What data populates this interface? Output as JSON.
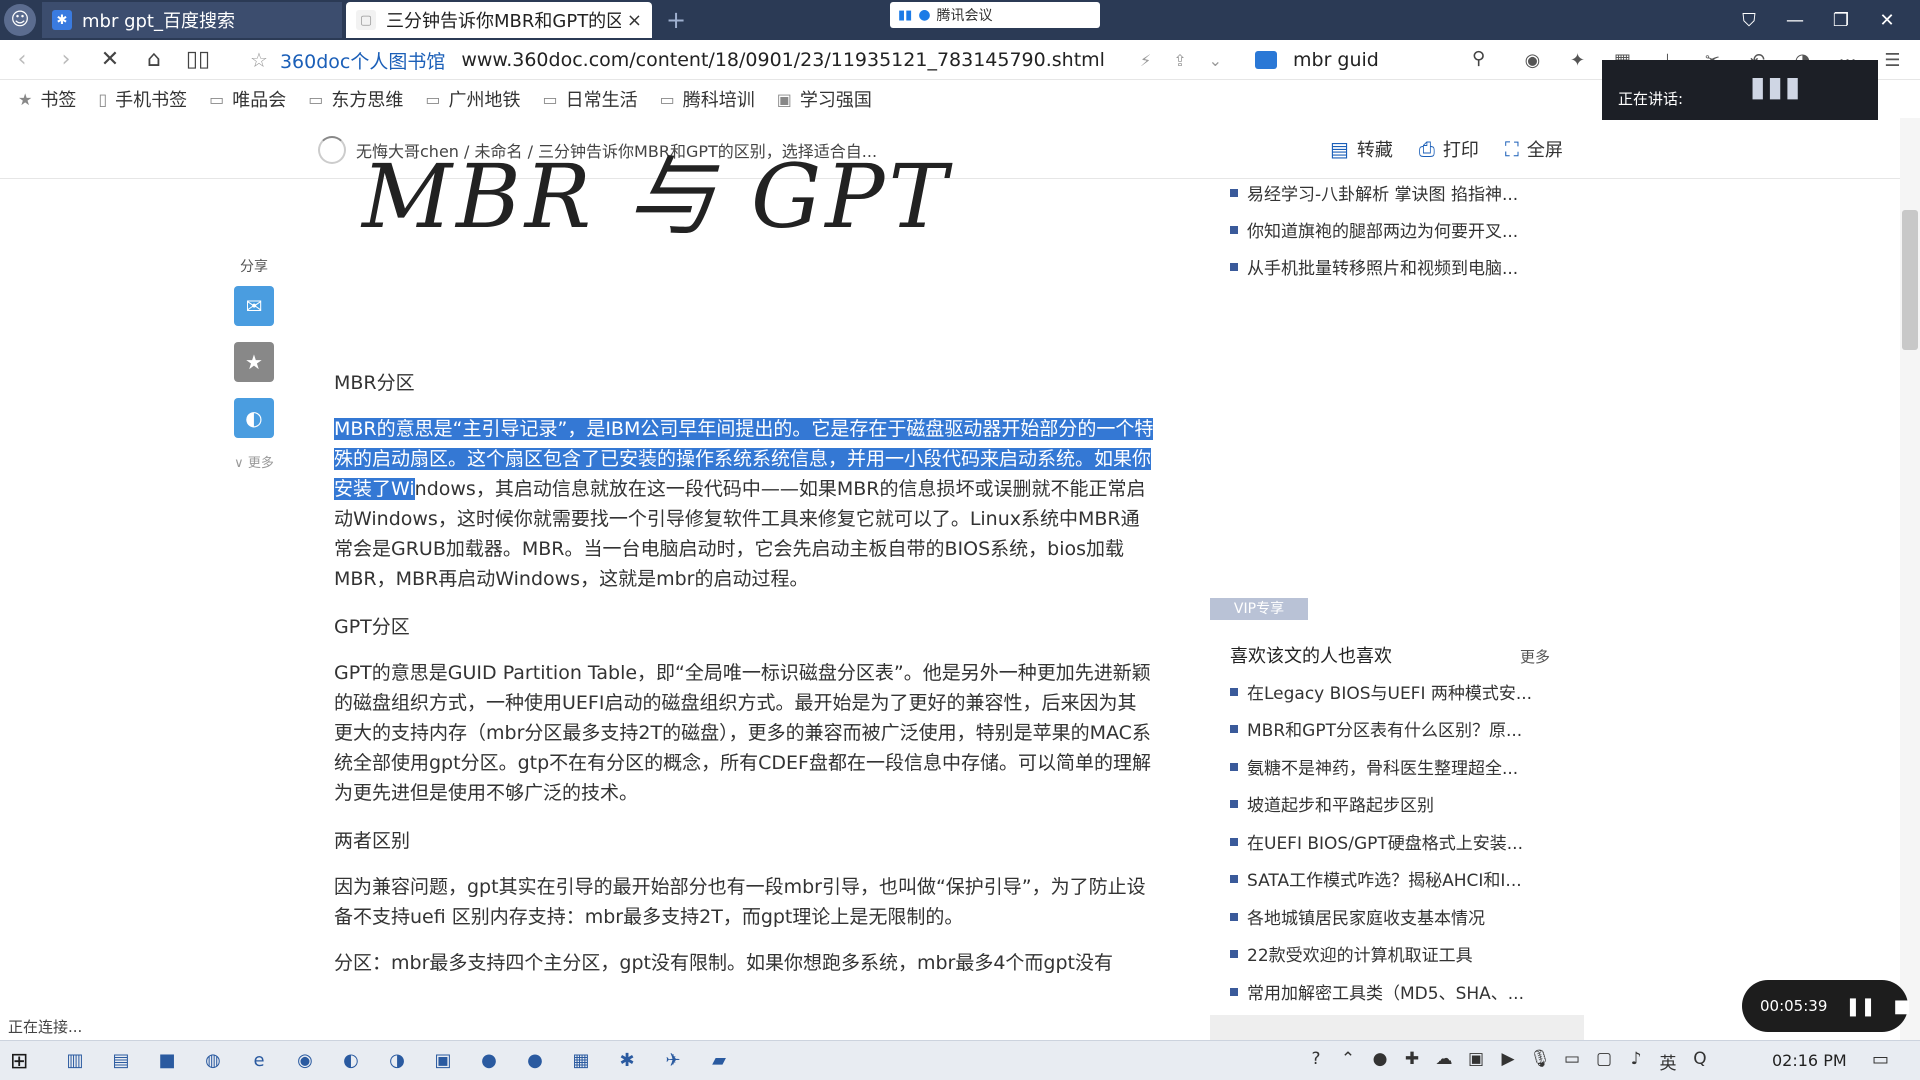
{
  "tabs": [
    {
      "title": "mbr gpt_百度搜索"
    },
    {
      "title": "三分钟告诉你MBR和GPT的区别",
      "close": "×"
    }
  ],
  "new_tab": "+",
  "meeting": {
    "label": "腾讯会议"
  },
  "nav": {
    "site_name": "360doc个人图书馆",
    "url": "www.360doc.com/content/18/0901/23/11935121_783145790.shtml",
    "search_query": "mbr guid"
  },
  "bookmarks": [
    "书签",
    "手机书签",
    "唯品会",
    "东方思维",
    "广州地铁",
    "日常生活",
    "腾科培训",
    "学习强国"
  ],
  "speaking": {
    "label": "正在讲话:"
  },
  "breadcrumb": "无悔大哥chen / 未命名 / 三分钟告诉你MBR和GPT的区别，选择适合自...",
  "actions": {
    "repost": "转藏",
    "print": "打印",
    "fullscreen": "全屏"
  },
  "share": {
    "label": "分享",
    "more": "更多"
  },
  "article": {
    "banner": "MBR 与 GPT",
    "sec1_title": "MBR分区",
    "p1_hl1": "MBR的意思是“主引导记录”，是IBM公司早年间提出的。它是存在于磁盘驱动器开始部分",
    "p1_hl2": "的一个特殊的启动扇区。这个扇区包含了已安装的操作系统系统信息，并用一小段代码来启动",
    "p1_hl3": "系统。如果你安装了Wi",
    "p1_rest": "ndows，其启动信息就放在这一段代码中——如果MBR的信息损坏或误删就不能正常启动Windows，这时候你就需要找一个引导修复软件工具来修复它就可以了。Linux系统中MBR通常会是GRUB加载器。MBR。当一台电脑启动时，它会先启动主板自带的BIOS系统，bios加载MBR，MBR再启动Windows，这就是mbr的启动过程。",
    "sec2_title": "GPT分区",
    "p2": "GPT的意思是GUID Partition Table，即“全局唯一标识磁盘分区表”。他是另外一种更加先进新颖的磁盘组织方式，一种使用UEFI启动的磁盘组织方式。最开始是为了更好的兼容性，后来因为其更大的支持内存（mbr分区最多支持2T的磁盘），更多的兼容而被广泛使用，特别是苹果的MAC系统全部使用gpt分区。gtp不在有分区的概念，所有CDEF盘都在一段信息中存储。可以简单的理解为更先进但是使用不够广泛的技术。",
    "sec3_title": "两者区别",
    "p3": "因为兼容问题，gpt其实在引导的最开始部分也有一段mbr引导，也叫做“保护引导”，为了防止设备不支持uefi 区别内存支持：mbr最多支持2T，而gpt理论上是无限制的。",
    "p4": "分区：mbr最多支持四个主分区，gpt没有限制。如果你想跑多系统，mbr最多4个而gpt没有"
  },
  "sidebar": {
    "top_items": [
      "易经学习-八卦解析 掌诀图 掐指神...",
      "你知道旗袍的腿部两边为何要开叉...",
      "从手机批量转移照片和视频到电脑..."
    ],
    "vip_label": "VIP专享",
    "heading": "喜欢该文的人也喜欢",
    "more": "更多",
    "items": [
      "在Legacy BIOS与UEFI 两种模式安...",
      "MBR和GPT分区表有什么区别？原...",
      "氨糖不是神药，骨科医生整理超全...",
      "坡道起步和平路起步区别",
      "在UEFI BIOS/GPT硬盘格式上安装...",
      "SATA工作模式咋选？揭秘AHCI和I...",
      "各地城镇居民家庭收支基本情况",
      "22款受欢迎的计算机取证工具",
      "常用加解密工具类（MD5、SHA、..."
    ]
  },
  "status": "正在连接...",
  "recorder": {
    "time": "00:05:39"
  },
  "clock": "02:16 PM"
}
